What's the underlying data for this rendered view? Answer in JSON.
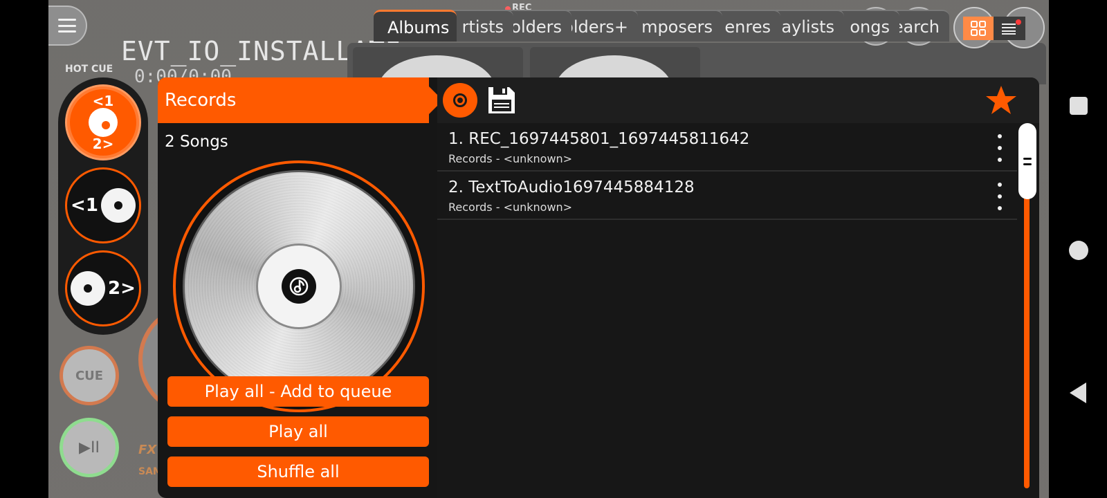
{
  "background": {
    "deck_title": "EVT_IO_INSTALLATI",
    "deck_time": "0:00/0:00",
    "hot_cue_label": "HOT CUE",
    "rec_indicator": "REC",
    "cue_label": "CUE",
    "play_pause_symbol": "▶II",
    "fx_label": "FX",
    "sampler_label": "SAM"
  },
  "tabs": [
    {
      "label": "Albums",
      "active": true
    },
    {
      "label": "rtists"
    },
    {
      "label": "olders"
    },
    {
      "label": "olders+"
    },
    {
      "label": "mposers"
    },
    {
      "label": "enres"
    },
    {
      "label": "aylists"
    },
    {
      "label": "ongs"
    },
    {
      "label": "earch"
    }
  ],
  "deck_selector": {
    "both_decks_label_top": "<1",
    "both_decks_label_bottom": "2>",
    "deck1_label": "<1",
    "deck2_label": "2>"
  },
  "album": {
    "title": "Records",
    "song_count": "2 Songs",
    "actions": {
      "play_all_queue": "Play all - Add to queue",
      "play_all": "Play all",
      "shuffle_all": "Shuffle all"
    }
  },
  "tracks": [
    {
      "title": "1. REC_1697445801_1697445811642",
      "subtitle": "Records - <unknown>"
    },
    {
      "title": "2. TextToAudio1697445884128",
      "subtitle": "Records - <unknown>"
    }
  ],
  "colors": {
    "accent": "#ff5a00",
    "panel": "#171717",
    "text": "#f2f2f2"
  },
  "icons": {
    "menu": "menu-icon",
    "record": "record-icon",
    "save": "floppy-disk-icon",
    "favorite": "star-icon",
    "grid_view": "grid-view-icon",
    "list_view": "list-view-icon",
    "more": "more-vertical-icon"
  }
}
